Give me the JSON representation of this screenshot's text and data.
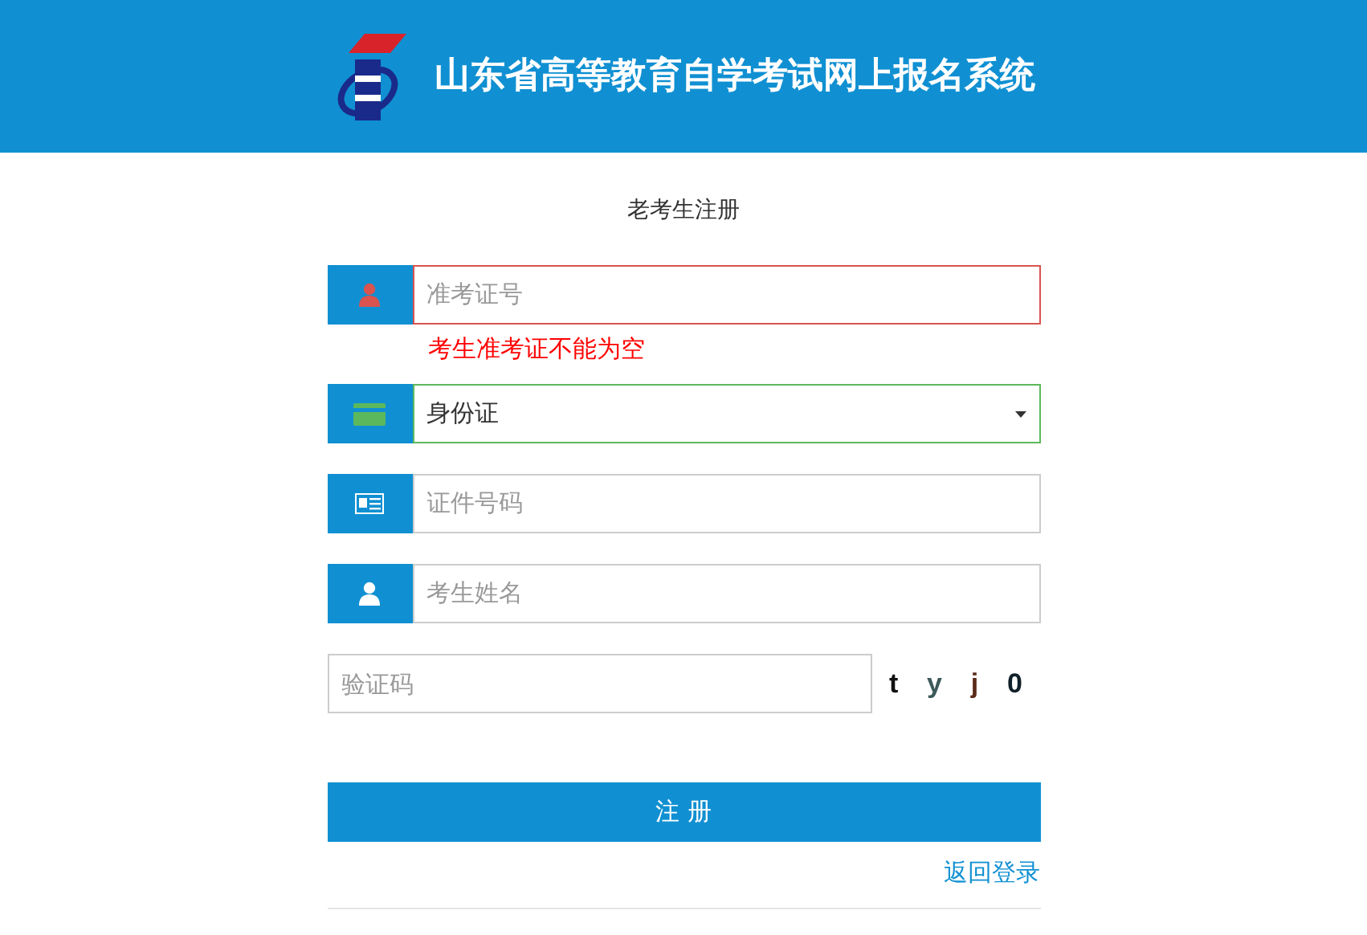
{
  "header": {
    "title": "山东省高等教育自学考试网上报名系统"
  },
  "page_title": "老考生注册",
  "fields": [
    {
      "kind": "person",
      "placeholder": "准考证号",
      "invalid": true,
      "valid": false,
      "error": "考生准考证不能为空"
    },
    {
      "kind": "card",
      "value": "身份证",
      "invalid": false,
      "valid": true
    },
    {
      "kind": "idcard",
      "placeholder": "证件号码",
      "invalid": false,
      "valid": false
    },
    {
      "kind": "person",
      "placeholder": "考生姓名",
      "invalid": false,
      "valid": false
    }
  ],
  "captcha": {
    "placeholder": "验证码",
    "characters": [
      {
        "text": "t",
        "color": "#111111"
      },
      {
        "text": "y",
        "color": "#3d5a5a"
      },
      {
        "text": "j",
        "color": "#5a2a1a"
      },
      {
        "text": "0",
        "color": "#10202a"
      }
    ]
  },
  "submit": "注 册",
  "back_link": "返回登录"
}
